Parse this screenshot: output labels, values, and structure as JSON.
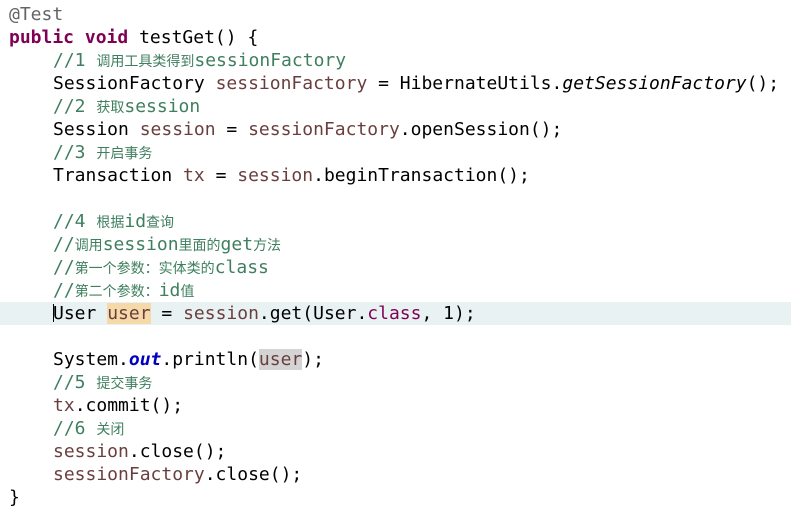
{
  "editor": {
    "lines": [
      {
        "tokens": [
          {
            "t": "@Test",
            "c": "c-ann"
          }
        ]
      },
      {
        "tokens": [
          {
            "t": "public",
            "c": "c-kw"
          },
          {
            "t": " "
          },
          {
            "t": "void",
            "c": "c-kw"
          },
          {
            "t": " testGet() {"
          }
        ]
      },
      {
        "indent": true,
        "tokens": [
          {
            "t": "//1 ",
            "c": "c-comment"
          },
          {
            "t": "调用工具类得到",
            "c": "c-comment c-cjk"
          },
          {
            "t": "sessionFactory",
            "c": "c-comment"
          }
        ]
      },
      {
        "indent": true,
        "tokens": [
          {
            "t": "SessionFactory "
          },
          {
            "t": "sessionFactory",
            "c": "c-field"
          },
          {
            "t": " = HibernateUtils."
          },
          {
            "t": "getSessionFactory",
            "c": "c-ital"
          },
          {
            "t": "();"
          }
        ]
      },
      {
        "indent": true,
        "tokens": [
          {
            "t": "//2 ",
            "c": "c-comment"
          },
          {
            "t": "获取",
            "c": "c-comment c-cjk"
          },
          {
            "t": "session",
            "c": "c-comment"
          }
        ]
      },
      {
        "indent": true,
        "tokens": [
          {
            "t": "Session "
          },
          {
            "t": "session",
            "c": "c-field"
          },
          {
            "t": " = "
          },
          {
            "t": "sessionFactory",
            "c": "c-field"
          },
          {
            "t": ".openSession();"
          }
        ]
      },
      {
        "indent": true,
        "tokens": [
          {
            "t": "//3 ",
            "c": "c-comment"
          },
          {
            "t": "开启事务",
            "c": "c-comment c-cjk"
          }
        ]
      },
      {
        "indent": true,
        "tokens": [
          {
            "t": "Transaction "
          },
          {
            "t": "tx",
            "c": "c-field"
          },
          {
            "t": " = "
          },
          {
            "t": "session",
            "c": "c-field"
          },
          {
            "t": ".beginTransaction();"
          }
        ]
      },
      {
        "indent": true,
        "tokens": []
      },
      {
        "indent": true,
        "tokens": [
          {
            "t": "//4 ",
            "c": "c-comment"
          },
          {
            "t": "根据",
            "c": "c-comment c-cjk"
          },
          {
            "t": "id",
            "c": "c-comment"
          },
          {
            "t": "查询",
            "c": "c-comment c-cjk"
          }
        ]
      },
      {
        "indent": true,
        "tokens": [
          {
            "t": "//",
            "c": "c-comment"
          },
          {
            "t": "调用",
            "c": "c-comment c-cjk"
          },
          {
            "t": "session",
            "c": "c-comment"
          },
          {
            "t": "里面的",
            "c": "c-comment c-cjk"
          },
          {
            "t": "get",
            "c": "c-comment"
          },
          {
            "t": "方法",
            "c": "c-comment c-cjk"
          }
        ]
      },
      {
        "indent": true,
        "tokens": [
          {
            "t": "//",
            "c": "c-comment"
          },
          {
            "t": "第一个参数：实体类的",
            "c": "c-comment c-cjk"
          },
          {
            "t": "class",
            "c": "c-comment"
          }
        ]
      },
      {
        "indent": true,
        "tokens": [
          {
            "t": "//",
            "c": "c-comment"
          },
          {
            "t": "第二个参数：",
            "c": "c-comment c-cjk"
          },
          {
            "t": "id",
            "c": "c-comment"
          },
          {
            "t": "值",
            "c": "c-comment c-cjk"
          }
        ]
      },
      {
        "indent": true,
        "current": true,
        "caret": true,
        "tokens": [
          {
            "t": "User "
          },
          {
            "t": "user",
            "c": "c-field hl-def"
          },
          {
            "t": " = "
          },
          {
            "t": "session",
            "c": "c-field"
          },
          {
            "t": ".get(User."
          },
          {
            "t": "class",
            "c": "c-kw2"
          },
          {
            "t": ", 1);"
          }
        ]
      },
      {
        "indent": true,
        "tokens": []
      },
      {
        "indent": true,
        "tokens": [
          {
            "t": "System."
          },
          {
            "t": "out",
            "c": "c-static"
          },
          {
            "t": ".println("
          },
          {
            "t": "user",
            "c": "c-field hl-use"
          },
          {
            "t": ");"
          }
        ]
      },
      {
        "indent": true,
        "tokens": [
          {
            "t": "//5 ",
            "c": "c-comment"
          },
          {
            "t": "提交事务",
            "c": "c-comment c-cjk"
          }
        ]
      },
      {
        "indent": true,
        "tokens": [
          {
            "t": "tx",
            "c": "c-field"
          },
          {
            "t": ".commit();"
          }
        ]
      },
      {
        "indent": true,
        "tokens": [
          {
            "t": "//6 ",
            "c": "c-comment"
          },
          {
            "t": "关闭",
            "c": "c-comment c-cjk"
          }
        ]
      },
      {
        "indent": true,
        "tokens": [
          {
            "t": "session",
            "c": "c-field"
          },
          {
            "t": ".close();"
          }
        ]
      },
      {
        "indent": true,
        "tokens": [
          {
            "t": "sessionFactory",
            "c": "c-field"
          },
          {
            "t": ".close();"
          }
        ]
      },
      {
        "tokens": [
          {
            "t": "}"
          }
        ]
      }
    ]
  }
}
